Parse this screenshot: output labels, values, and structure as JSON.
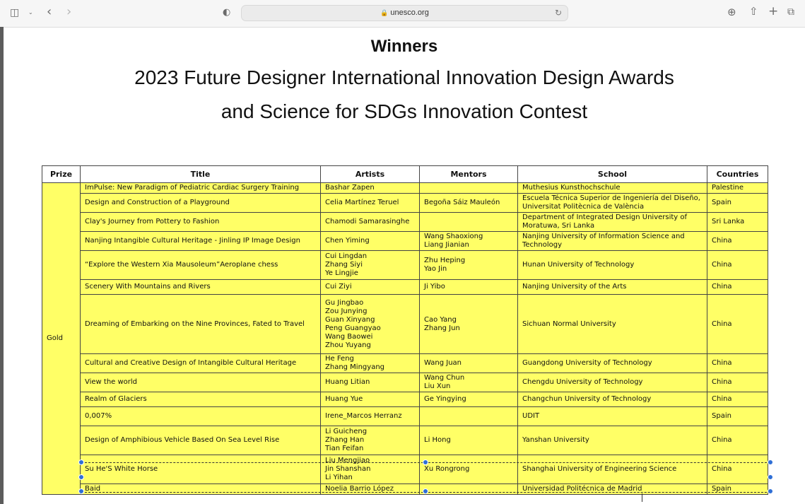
{
  "browser": {
    "url": "unesco.org",
    "icons": {
      "sidebar": "sidebar-icon",
      "back": "back-icon",
      "forward": "forward-icon",
      "shield": "shield-icon",
      "lock": "lock-icon",
      "reload": "reload-icon",
      "download": "download-icon",
      "share": "share-icon",
      "new_tab": "plus-icon",
      "tabs": "tabs-icon"
    }
  },
  "document": {
    "heading": "Winners",
    "title_line1": "2023 Future Designer International Innovation Design Awards",
    "title_line2": "and Science for SDGs Innovation Contest"
  },
  "table": {
    "headers": [
      "Prize",
      "Title",
      "Artists",
      "Mentors",
      "School",
      "Countries"
    ],
    "prize": "Gold",
    "rows": [
      {
        "title": "ImPulse:  New Paradigm of Pediatric Cardiac Surgery Training",
        "artists": [
          "Bashar Zapen"
        ],
        "mentors": [],
        "school": [
          "Muthesius Kunsthochschule"
        ],
        "country": "Palestine"
      },
      {
        "title": "Design and Construction of a Playground",
        "artists": [
          "Celia Martínez Teruel"
        ],
        "mentors": [
          "Begoña Sáiz Mauleón"
        ],
        "school": [
          "Escuela Técnica Superior de Ingeniería del Diseño,",
          "Universitat Politècnica de València"
        ],
        "country": "Spain"
      },
      {
        "title": "Clay's Journey from Pottery to Fashion",
        "artists": [
          "Chamodi Samarasinghe"
        ],
        "mentors": [],
        "school": [
          "Department of Integrated Design University of",
          "Moratuwa, Sri Lanka"
        ],
        "country": "Sri Lanka"
      },
      {
        "title": "Nanjing Intangible Cultural Heritage - Jinling IP Image Design",
        "artists": [
          "Chen Yiming"
        ],
        "mentors": [
          "Wang Shaoxiong",
          "Liang Jianian"
        ],
        "school": [
          "Nanjing University of Information Science and",
          "Technology"
        ],
        "country": "China"
      },
      {
        "title": "“Explore the Western Xia Mausoleum”Aeroplane chess",
        "artists": [
          "Cui Lingdan",
          "Zhang Siyi",
          "Ye Lingjie"
        ],
        "mentors": [
          "Zhu Heping",
          "Yao Jin"
        ],
        "school": [
          "Hunan University of Technology"
        ],
        "country": "China"
      },
      {
        "title": "Scenery With Mountains and Rivers",
        "artists": [
          "Cui Ziyi"
        ],
        "mentors": [
          "Ji Yibo"
        ],
        "school": [
          "Nanjing University of the Arts"
        ],
        "country": "China"
      },
      {
        "title": "Dreaming of Embarking on the Nine Provinces, Fated to Travel",
        "artists": [
          "Gu Jingbao",
          "Zou Junying",
          "Guan Xinyang",
          "Peng Guangyao",
          "Wang Baowei",
          "Zhou Yuyang"
        ],
        "mentors": [
          "Cao Yang",
          "Zhang Jun"
        ],
        "school": [
          "Sichuan Normal University"
        ],
        "country": "China"
      },
      {
        "title": "Cultural and Creative Design of Intangible Cultural Heritage",
        "artists": [
          "He Feng",
          "Zhang Mingyang"
        ],
        "mentors": [
          "Wang Juan"
        ],
        "school": [
          "Guangdong University of Technology"
        ],
        "country": "China"
      },
      {
        "title": "View the world",
        "artists": [
          "Huang Litian"
        ],
        "mentors": [
          "Wang Chun",
          "Liu Xun"
        ],
        "school": [
          "Chengdu University of Technology"
        ],
        "country": "China"
      },
      {
        "title": "Realm of Glaciers",
        "artists": [
          "Huang Yue"
        ],
        "mentors": [
          "Ge Yingying"
        ],
        "school": [
          "Changchun University of Technology"
        ],
        "country": "China"
      },
      {
        "title": "0,007%",
        "artists": [
          "Irene_Marcos Herranz"
        ],
        "mentors": [],
        "school": [
          "UDIT"
        ],
        "country": "Spain"
      },
      {
        "title": "Design of Amphibious Vehicle Based On Sea Level Rise",
        "artists": [
          "Li Guicheng",
          "Zhang Han",
          "Tian Feifan"
        ],
        "mentors": [
          "Li Hong"
        ],
        "school": [
          "Yanshan University"
        ],
        "country": "China"
      },
      {
        "title": "Su He'S White Horse",
        "artists": [
          "Liu Mengjiao",
          "Jin Shanshan",
          "Li Yihan"
        ],
        "mentors": [
          "Xu Rongrong"
        ],
        "school": [
          "Shanghai University of Engineering Science"
        ],
        "country": "China"
      },
      {
        "title": "Baid",
        "artists": [
          "Noelia Barrio López"
        ],
        "mentors": [],
        "school": [
          "Universidad Politécnica de Madrid"
        ],
        "country": "Spain"
      }
    ]
  },
  "colors": {
    "cell_background": "#ffff66",
    "selection_handle": "#2f6fd6"
  }
}
